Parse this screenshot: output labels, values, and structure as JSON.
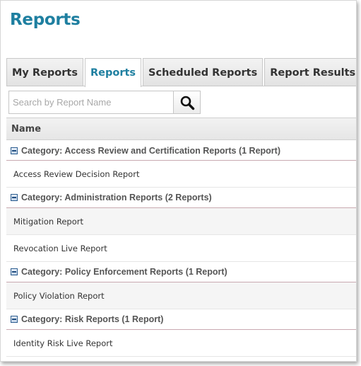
{
  "page": {
    "title": "Reports"
  },
  "tabs": [
    {
      "label": "My Reports",
      "active": false
    },
    {
      "label": "Reports",
      "active": true
    },
    {
      "label": "Scheduled Reports",
      "active": false
    },
    {
      "label": "Report Results",
      "active": false
    }
  ],
  "search": {
    "placeholder": "Search by Report Name",
    "value": "",
    "icon": "search-icon"
  },
  "grid": {
    "column_header": "Name",
    "categories": [
      {
        "label": "Category: Access Review and Certification Reports (1 Report)",
        "reports": [
          "Access Review Decision Report"
        ]
      },
      {
        "label": "Category: Administration Reports (2 Reports)",
        "reports": [
          "Mitigation Report",
          "Revocation Live Report"
        ]
      },
      {
        "label": "Category: Policy Enforcement Reports (1 Report)",
        "reports": [
          "Policy Violation Report"
        ]
      },
      {
        "label": "Category: Risk Reports (1 Report)",
        "reports": [
          "Identity Risk Live Report"
        ]
      }
    ]
  },
  "colors": {
    "accent": "#1e7fa0",
    "category_divider": "#c9a9b1"
  }
}
